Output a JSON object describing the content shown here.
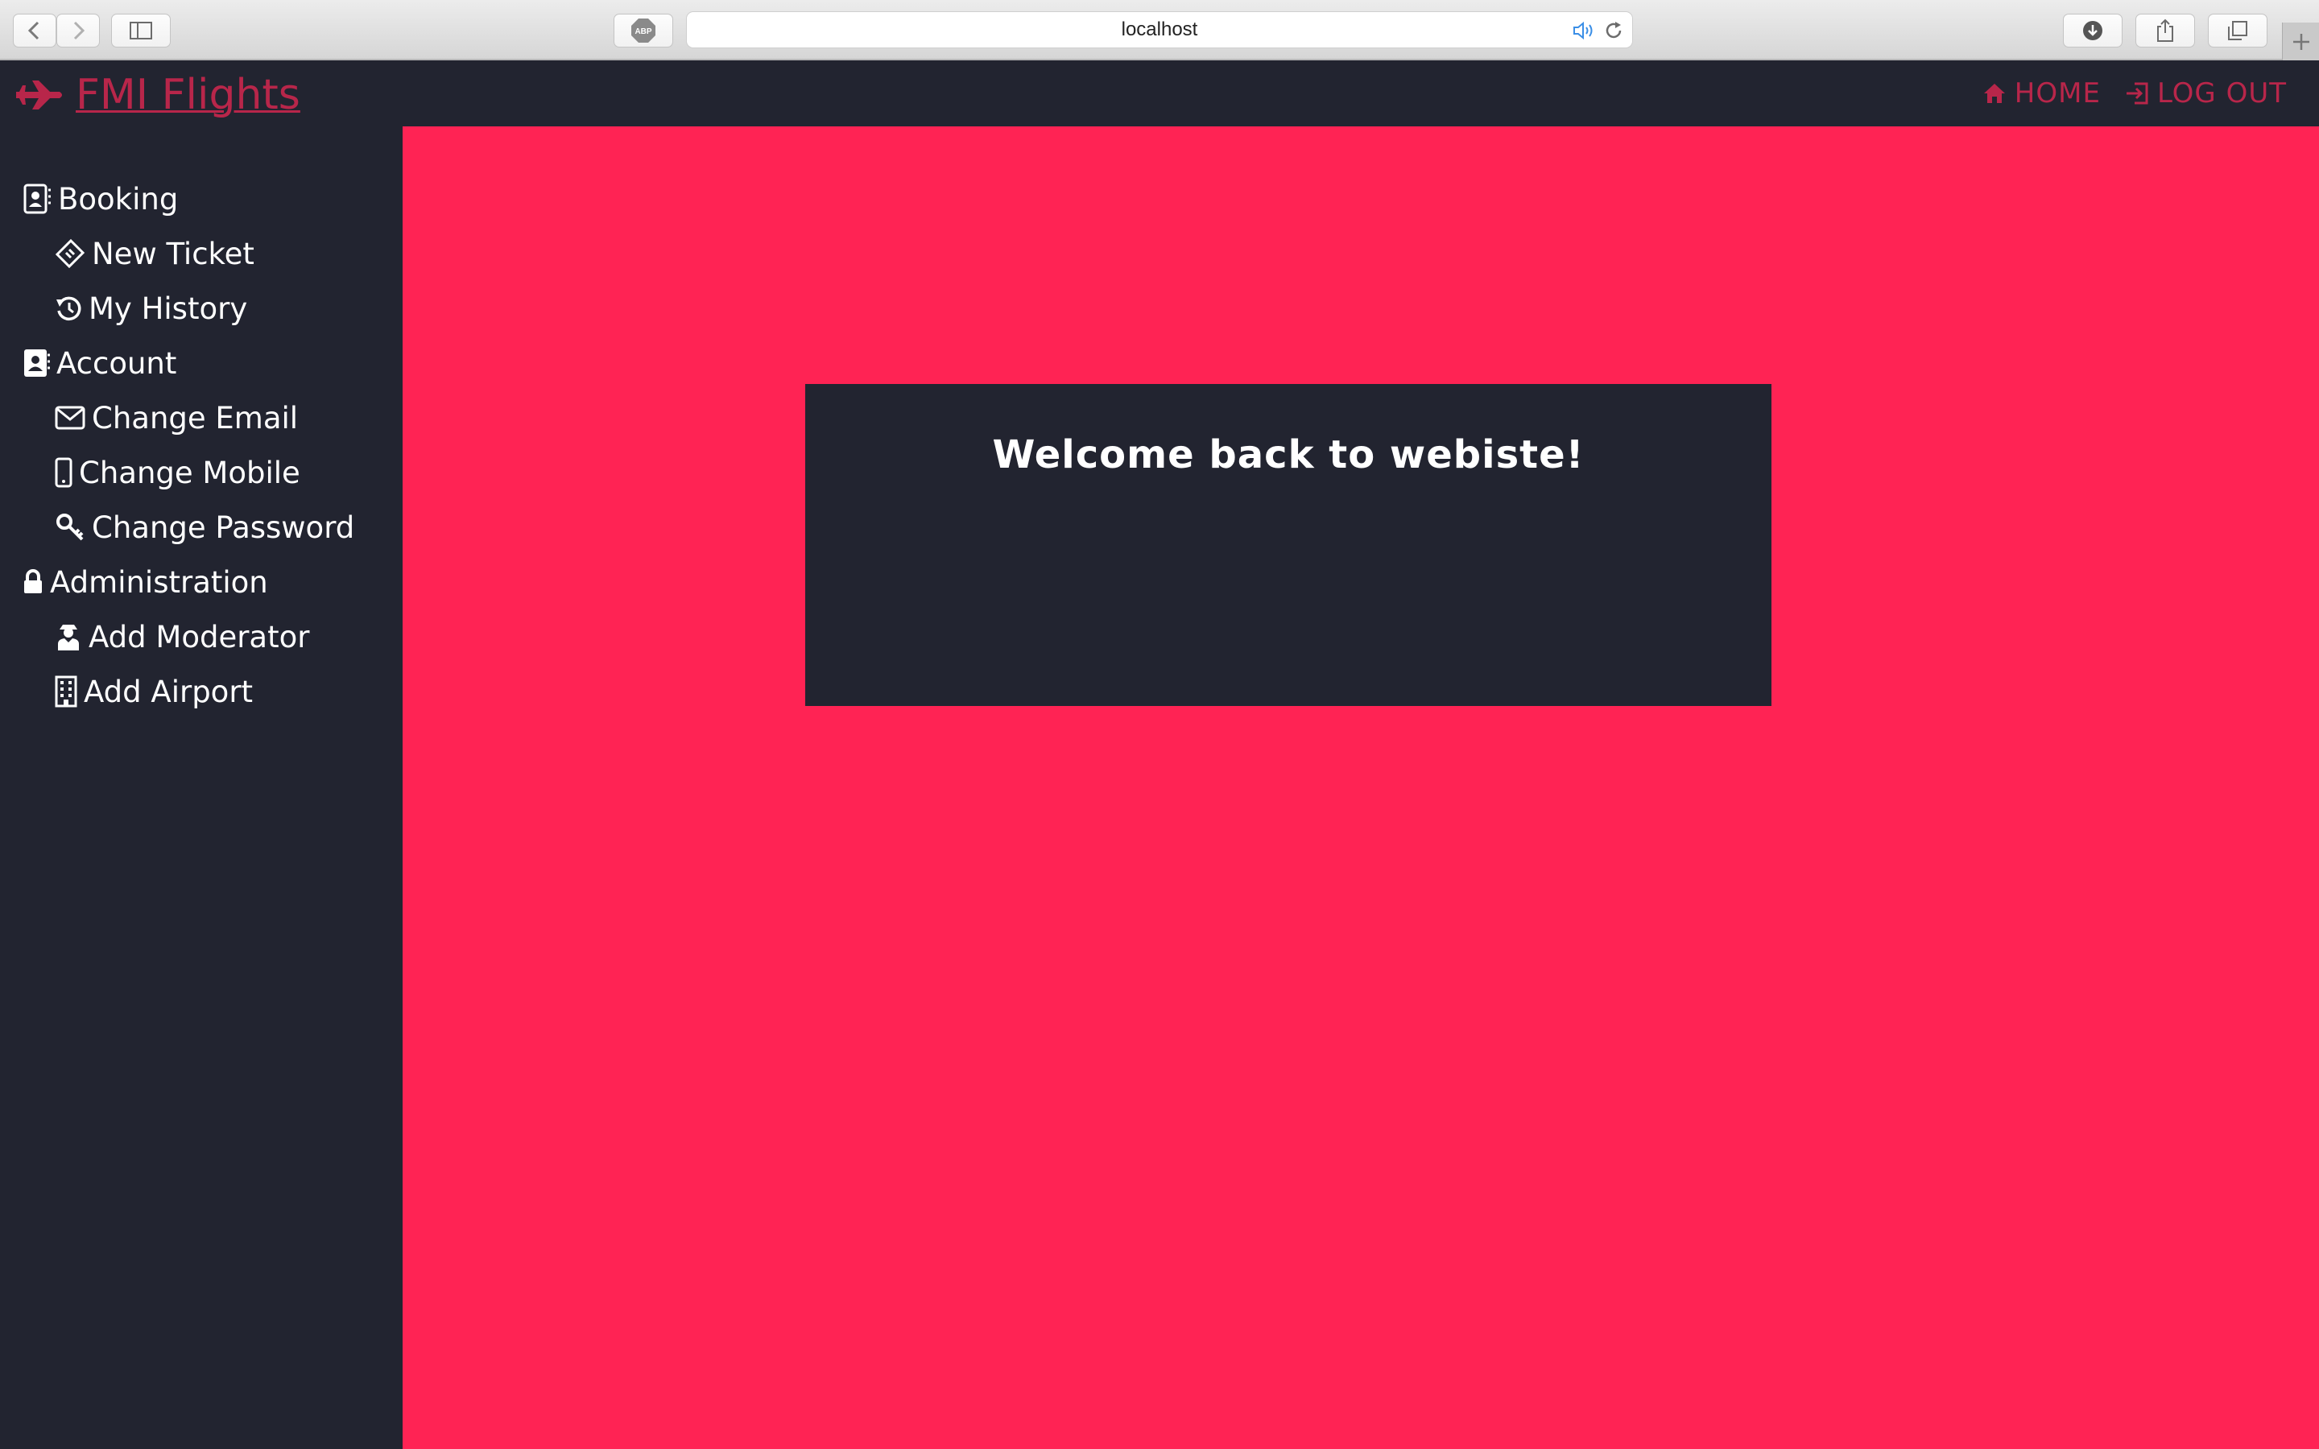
{
  "browser": {
    "url": "localhost",
    "icons": [
      "back-icon",
      "forward-icon",
      "sidebar-icon",
      "adblock-icon",
      "audio-icon",
      "reload-icon",
      "downloads-icon",
      "share-icon",
      "tabs-icon",
      "new-tab-icon"
    ],
    "adblock_label": "ABP"
  },
  "header": {
    "brand": "FMI Flights",
    "brand_icon": "plane-icon",
    "nav": [
      {
        "label": "HOME",
        "icon": "home-icon"
      },
      {
        "label": "LOG OUT",
        "icon": "logout-icon"
      }
    ]
  },
  "sidebar": {
    "items": [
      {
        "label": "Booking",
        "icon": "booking-icon",
        "type": "section"
      },
      {
        "label": "New Ticket",
        "icon": "ticket-icon",
        "type": "child"
      },
      {
        "label": "My History",
        "icon": "history-icon",
        "type": "child"
      },
      {
        "label": "Account",
        "icon": "contact-icon",
        "type": "section"
      },
      {
        "label": "Change Email",
        "icon": "envelope-icon",
        "type": "child"
      },
      {
        "label": "Change Mobile",
        "icon": "mobile-icon",
        "type": "child"
      },
      {
        "label": "Change Password",
        "icon": "key-icon",
        "type": "child"
      },
      {
        "label": "Administration",
        "icon": "lock-icon",
        "type": "section"
      },
      {
        "label": "Add Moderator",
        "icon": "moderator-icon",
        "type": "child"
      },
      {
        "label": "Add Airport",
        "icon": "building-icon",
        "type": "child"
      }
    ]
  },
  "main": {
    "welcome": "Welcome back to webiste!"
  },
  "colors": {
    "background_dark": "#222430",
    "accent": "#b8264a",
    "main_bg": "#ff2354",
    "text": "#ffffff"
  }
}
